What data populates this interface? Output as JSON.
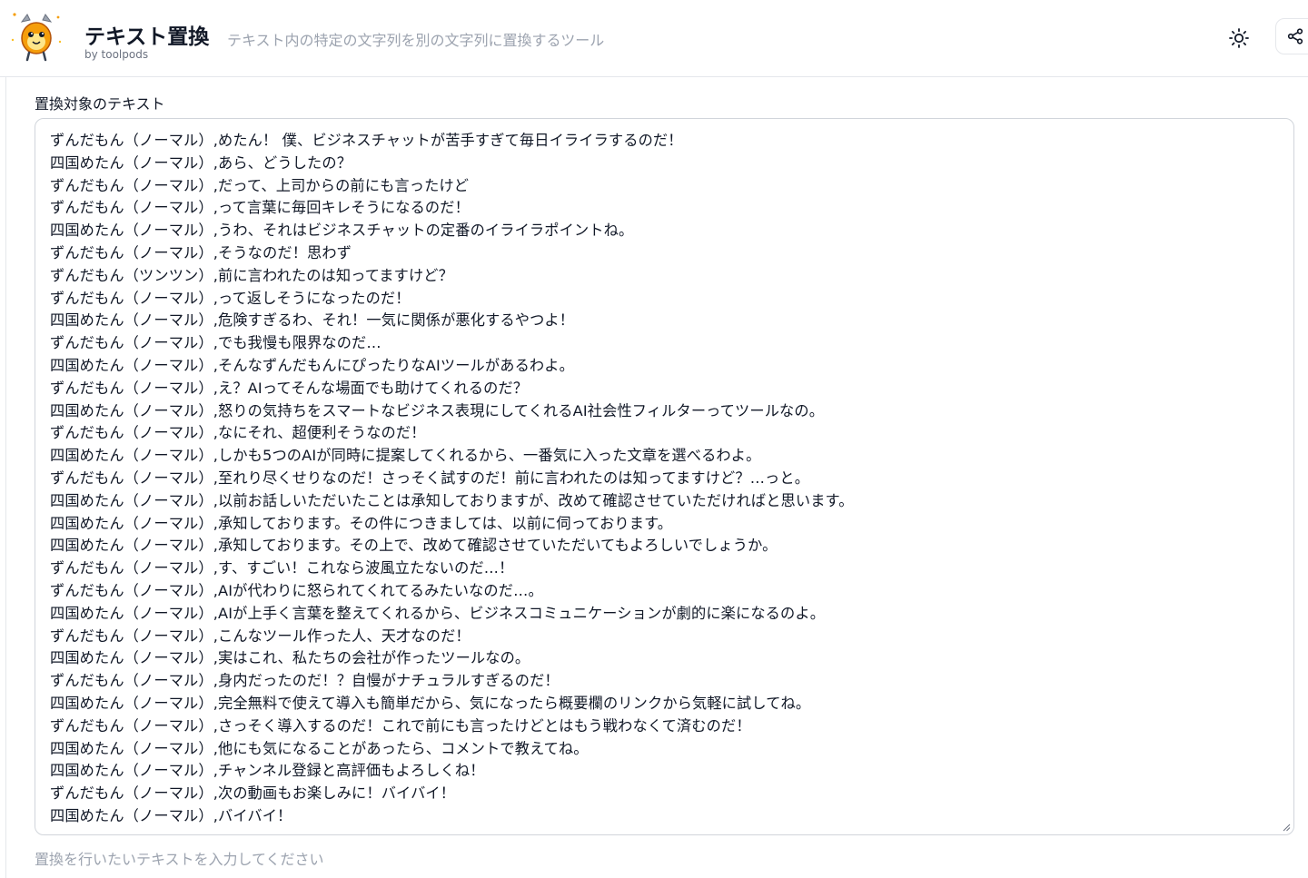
{
  "header": {
    "title": "テキスト置換",
    "byline": "by toolpods",
    "description": "テキスト内の特定の文字列を別の文字列に置換するツール",
    "theme_icon": "sun-icon",
    "share_icon": "share-icon",
    "logo_icon": "mascot-logo-icon"
  },
  "colors": {
    "accent": "#f59e0b",
    "border": "#e5e7eb",
    "muted_text": "#9ca3af"
  },
  "editor": {
    "label": "置換対象のテキスト",
    "helper": "置換を行いたいテキストを入力してください",
    "lines": [
      "ずんだもん（ノーマル）,めたん！ 僕、ビジネスチャットが苦手すぎて毎日イライラするのだ！",
      "四国めたん（ノーマル）,あら、どうしたの？",
      "ずんだもん（ノーマル）,だって、上司からの前にも言ったけど",
      "ずんだもん（ノーマル）,って言葉に毎回キレそうになるのだ！",
      "四国めたん（ノーマル）,うわ、それはビジネスチャットの定番のイライラポイントね。",
      "ずんだもん（ノーマル）,そうなのだ！思わず",
      "ずんだもん（ツンツン）,前に言われたのは知ってますけど？",
      "ずんだもん（ノーマル）,って返しそうになったのだ！",
      "四国めたん（ノーマル）,危険すぎるわ、それ！一気に関係が悪化するやつよ！",
      "ずんだもん（ノーマル）,でも我慢も限界なのだ…",
      "四国めたん（ノーマル）,そんなずんだもんにぴったりなAIツールがあるわよ。",
      "ずんだもん（ノーマル）,え？AIってそんな場面でも助けてくれるのだ？",
      "四国めたん（ノーマル）,怒りの気持ちをスマートなビジネス表現にしてくれるAI社会性フィルターってツールなの。",
      "ずんだもん（ノーマル）,なにそれ、超便利そうなのだ！",
      "四国めたん（ノーマル）,しかも5つのAIが同時に提案してくれるから、一番気に入った文章を選べるわよ。",
      "ずんだもん（ノーマル）,至れり尽くせりなのだ！さっそく試すのだ！前に言われたのは知ってますけど？…っと。",
      "四国めたん（ノーマル）,以前お話しいただいたことは承知しておりますが、改めて確認させていただければと思います。",
      "四国めたん（ノーマル）,承知しております。その件につきましては、以前に伺っております。",
      "四国めたん（ノーマル）,承知しております。その上で、改めて確認させていただいてもよろしいでしょうか。",
      "ずんだもん（ノーマル）,す、すごい！これなら波風立たないのだ…！",
      "ずんだもん（ノーマル）,AIが代わりに怒られてくれてるみたいなのだ…。",
      "四国めたん（ノーマル）,AIが上手く言葉を整えてくれるから、ビジネスコミュニケーションが劇的に楽になるのよ。",
      "ずんだもん（ノーマル）,こんなツール作った人、天才なのだ！",
      "四国めたん（ノーマル）,実はこれ、私たちの会社が作ったツールなの。",
      "ずんだもん（ノーマル）,身内だったのだ！？自慢がナチュラルすぎるのだ！",
      "四国めたん（ノーマル）,完全無料で使えて導入も簡単だから、気になったら概要欄のリンクから気軽に試してね。",
      "ずんだもん（ノーマル）,さっそく導入するのだ！これで前にも言ったけどとはもう戦わなくて済むのだ！",
      "四国めたん（ノーマル）,他にも気になることがあったら、コメントで教えてね。",
      "四国めたん（ノーマル）,チャンネル登録と高評価もよろしくね！",
      "ずんだもん（ノーマル）,次の動画もお楽しみに！バイバイ！",
      "四国めたん（ノーマル）,バイバイ！"
    ]
  }
}
